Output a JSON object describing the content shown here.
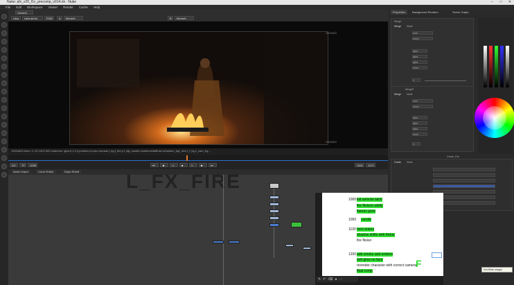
{
  "app": {
    "title": "Nuke: pfx_v20_f1v_precomp_v014.nk - Nuke"
  },
  "menu": [
    "File",
    "Edit",
    "Workspace",
    "Viewer",
    "Render",
    "Cache",
    "Help"
  ],
  "viewer": {
    "tab": "Viewer1",
    "channels": "rgba",
    "layer": "rgba.alpha",
    "gain_label": "RGB",
    "input_a": "A",
    "input_a_node": "Merge6",
    "input_b": "B",
    "input_b_node": "Merge6",
    "resolution": "1920x823",
    "frame_label_top": "1920x823",
    "frame_label_bottom": "1920x823",
    "status": "1920x823 bbox: 0 -20 1922 843 channels: rgba,0,1,2,3,position,N,cols,normals,f_bg,f_fire,p.f_ligt_candle,combineeddiffuse,refraction_bgr_emr,f_f_bg,v_cam_bg,..."
  },
  "timeline": {
    "fps": "24*",
    "mode": "TF",
    "frame": "1035",
    "start": "1001",
    "end": "1170"
  },
  "nodegraph": {
    "tabs": [
      "Node Graph",
      "Curve Editor",
      "Dope Sheet"
    ],
    "watermark": "L_FX_FIRE"
  },
  "right": {
    "tabs": [
      "Properties",
      "Background Renders",
      "Scene Graph"
    ],
    "merge_a": {
      "title": "Merge",
      "tabs": [
        "Merge",
        "Node"
      ],
      "operation": "over",
      "bbox": "union",
      "mask": "rgba.alpha",
      "a_channels": "rgba",
      "b_channels": "rgba",
      "output": "rgba",
      "also_merge": "none",
      "mix": "1"
    },
    "merge_b": {
      "title": "Merge5",
      "tabs": [
        "Merge",
        "Node"
      ],
      "operation": "over",
      "bbox": "union",
      "a_channels": "rgba",
      "b_channels": "rgba",
      "output": "rgba",
      "also_merge": "none",
      "mix": "1"
    },
    "lower": {
      "tabs": [
        "Grade",
        "Node"
      ],
      "title": "Grade_Fire"
    },
    "colorwheel": "color-wheel"
  },
  "doc": {
    "lines": [
      {
        "frame": "1000",
        "text": "kid unlocks latch",
        "hl": true
      },
      {
        "frame": "",
        "text": "fire flickers wildly",
        "hl": true
      },
      {
        "frame": "",
        "text": "flames grow",
        "hl": true
      },
      {
        "frame": "1050",
        "text": "candle",
        "hl": true
      },
      {
        "frame": "1100",
        "text": "hero enters",
        "hl": true
      },
      {
        "frame": "",
        "text": "shadow shifts with flicker",
        "hl": true
      },
      {
        "frame": "",
        "text": "fire flicker",
        "hl": false
      },
      {
        "frame": "1200",
        "text": "add smoke and embers",
        "hl": true
      },
      {
        "frame": "",
        "text": "soft glow on face",
        "hl": true
      },
      {
        "frame": "",
        "text": "rerender character with correct camera",
        "hl": false
      },
      {
        "frame": "",
        "text": "final comp",
        "hl": true
      }
    ],
    "annotation": "F",
    "tooltip": "Sort/Hide margin"
  },
  "colors": {
    "accent": "#2fe02f",
    "orange": "#e07a2a",
    "panel": "#2a2a2a"
  }
}
